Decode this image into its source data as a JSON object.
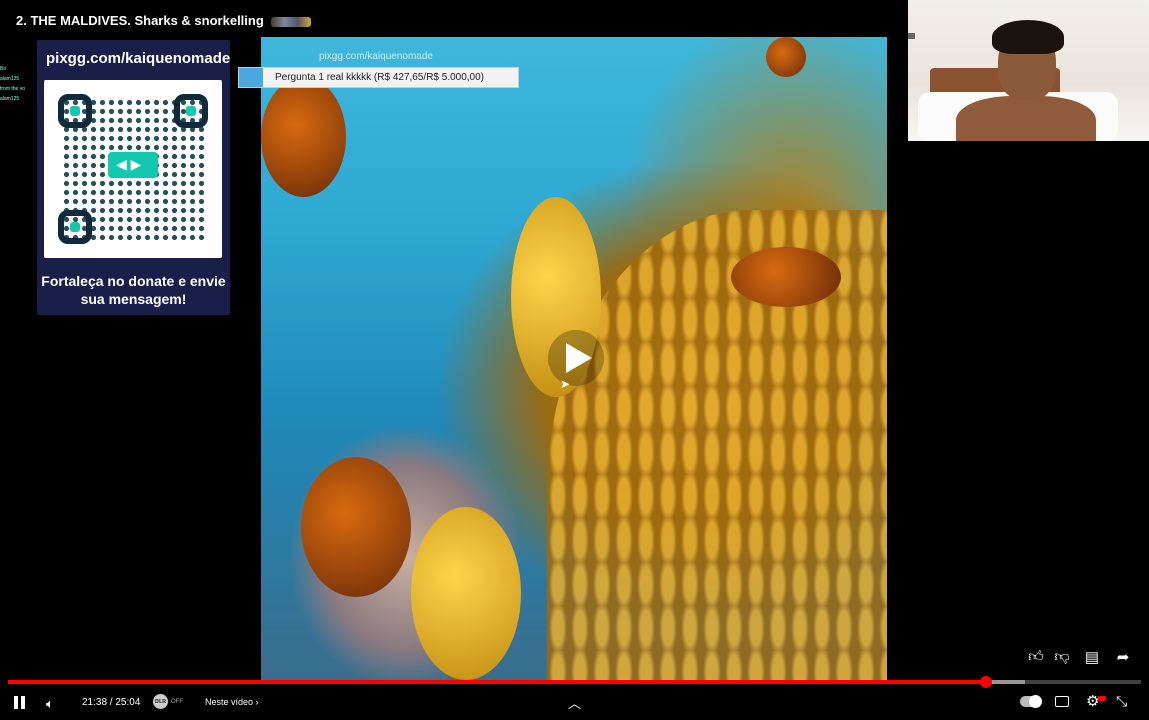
{
  "video": {
    "title": "2. THE MALDIVES. Sharks & snorkelling",
    "watermark": "pixgg.com/kaiquenomade"
  },
  "overlay": {
    "donate_url": "pixgg.com/kaiquenomade",
    "donate_message": "Fortaleça no donate e envie sua mensagem!",
    "goal_text": "Pergunta 1 real kkkkk (R$ 427,65/R$ 5.000,00)",
    "goal_progress": 0.0855
  },
  "chat_ghost": [
    "Bo",
    "alam125",
    "from the vo",
    "alam125"
  ],
  "player": {
    "time": "21:38 / 25:04",
    "played_fraction": 0.863,
    "buffered_fraction": 0.898,
    "dlr_label": "OFF",
    "dlr_icon": "ᴅʟʀ",
    "chapter_label": "Neste vídeo",
    "chevron": "›",
    "icons": {
      "pause": "pause-icon",
      "volume": "volume-icon",
      "chevron_up": "chevron-up-icon",
      "like": "thumbs-up-icon",
      "dislike": "thumbs-down-icon",
      "comment": "comment-icon",
      "share": "share-icon",
      "settings": "gear-icon",
      "exit_fullscreen": "exit-fullscreen-icon"
    }
  },
  "colors": {
    "accent": "#ff0000",
    "panel": "#1a1f4a",
    "qr_accent": "#12c9b0"
  }
}
